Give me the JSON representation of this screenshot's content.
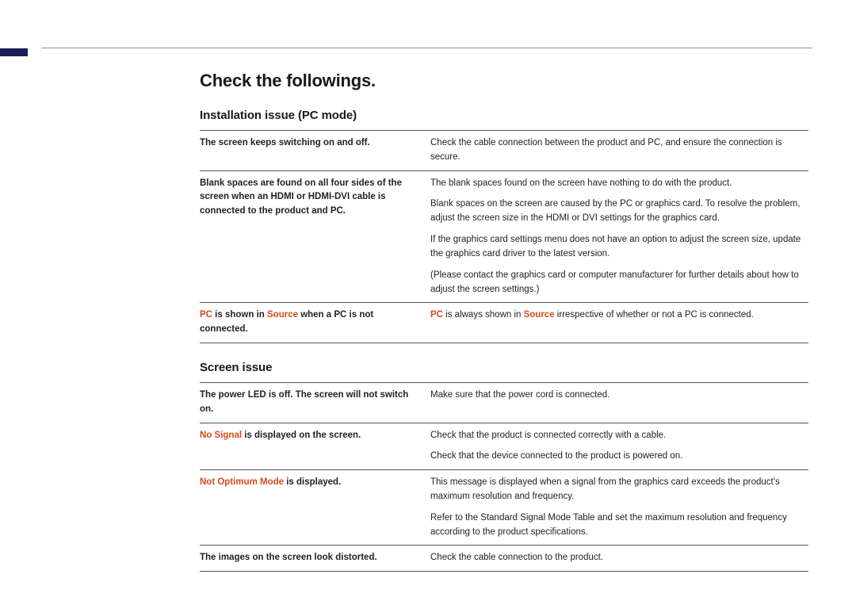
{
  "title": "Check the followings.",
  "sections": {
    "install": {
      "heading": "Installation issue (PC mode)",
      "rows": {
        "r0": {
          "sym": "The screen keeps switching on and off.",
          "sol": "Check the cable connection between the product and PC, and ensure the connection is secure."
        },
        "r1": {
          "sym": "Blank spaces are found on all four sides of the screen when an HDMI or HDMI-DVI cable is connected to the product and PC.",
          "sol_p0": "The blank spaces found on the screen have nothing to do with the product.",
          "sol_p1": "Blank spaces on the screen are caused by the PC or graphics card. To resolve the problem, adjust the screen size in the HDMI or DVI settings for the graphics card.",
          "sol_p2": "If the graphics card settings menu does not have an option to adjust the screen size, update the graphics card driver to the latest version.",
          "sol_p3": "(Please contact the graphics card or computer manufacturer for further details about how to adjust the screen settings.)"
        },
        "r2": {
          "sym_pre": "PC",
          "sym_mid": " is shown in ",
          "sym_src": "Source",
          "sym_post": " when a PC is not connected.",
          "sol_pre": "PC",
          "sol_mid": " is always shown in ",
          "sol_src": "Source",
          "sol_post": " irrespective of whether or not a PC is connected."
        }
      }
    },
    "screen": {
      "heading": "Screen issue",
      "rows": {
        "r0": {
          "sym": "The power LED is off. The screen will not switch on.",
          "sol": "Make sure that the power cord is connected."
        },
        "r1": {
          "sym_hl": "No Signal",
          "sym_post": " is displayed on the screen.",
          "sol_p0": "Check that the product is connected correctly with a cable.",
          "sol_p1": "Check that the device connected to the product is powered on."
        },
        "r2": {
          "sym_hl": "Not Optimum Mode",
          "sym_post": " is displayed.",
          "sol_p0": "This message is displayed when a signal from the graphics card exceeds the product's maximum resolution and frequency.",
          "sol_p1": "Refer to the Standard Signal Mode Table and set the maximum resolution and frequency according to the product specifications."
        },
        "r3": {
          "sym": "The images on the screen look distorted.",
          "sol": "Check the cable connection to the product."
        }
      }
    }
  }
}
